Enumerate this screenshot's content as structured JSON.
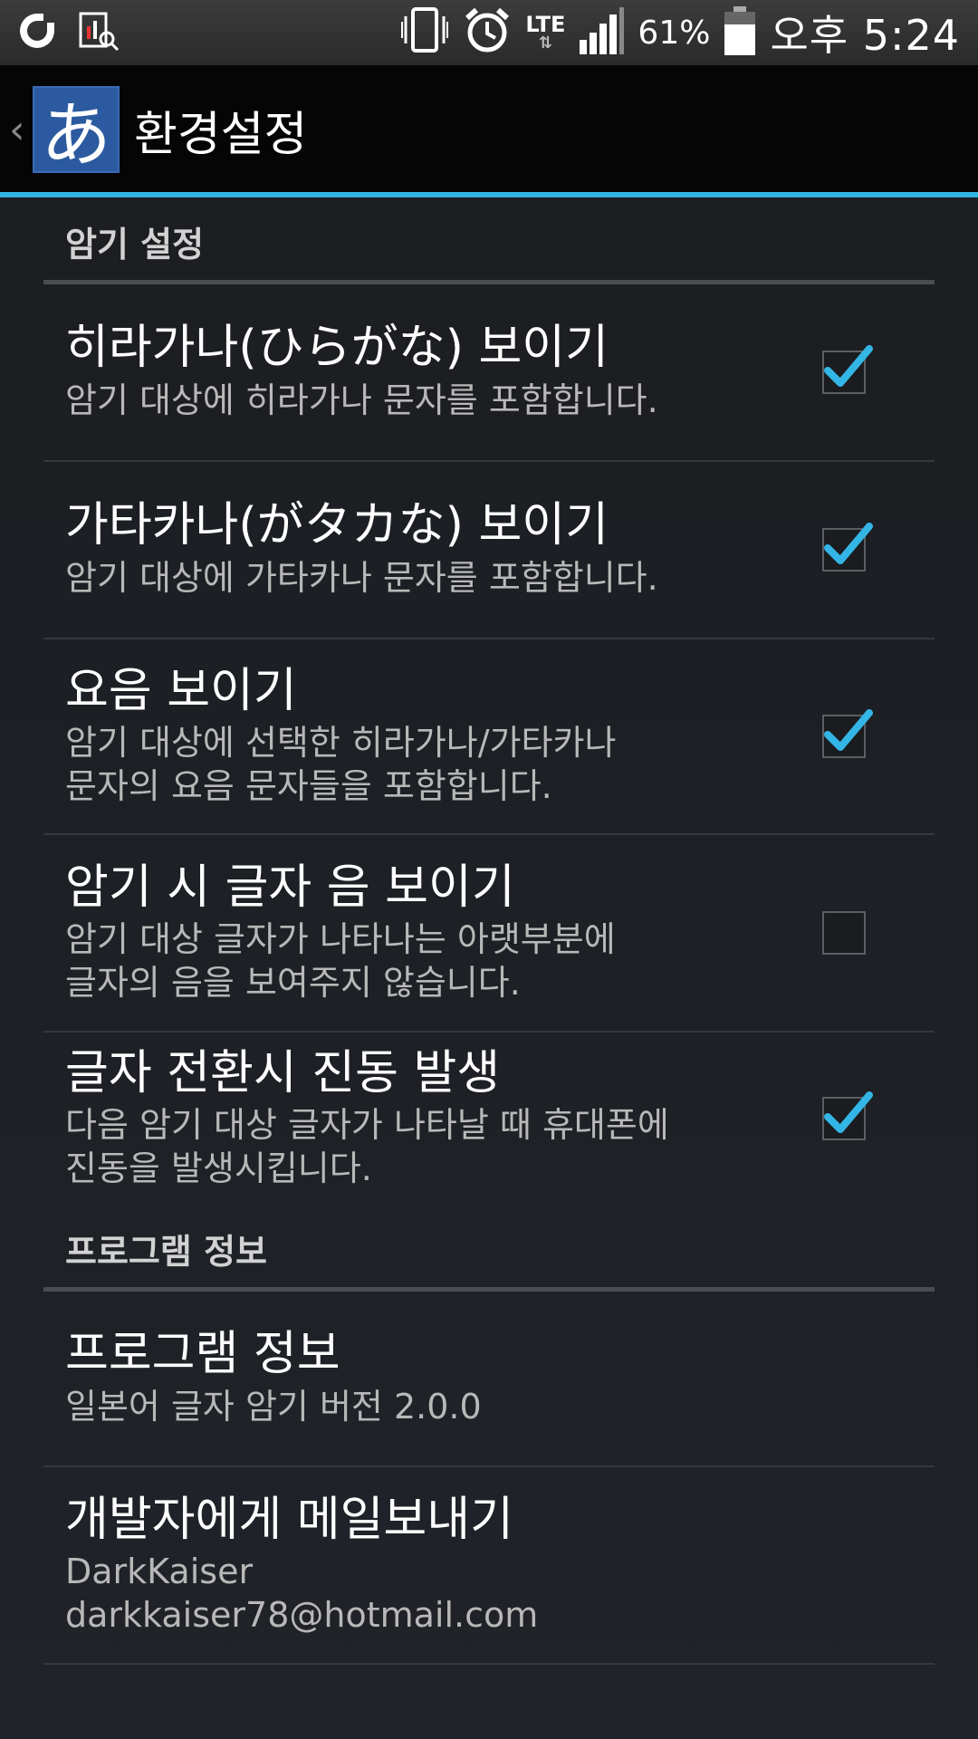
{
  "statusbar": {
    "battery_percent": "61%",
    "time": "오후 5:24",
    "network": "LTE",
    "icons": [
      "app-logo-icon",
      "monitor-icon",
      "vibrate-icon",
      "alarm-icon",
      "lte-icon",
      "signal-icon",
      "battery-icon"
    ]
  },
  "actionbar": {
    "app_icon_glyph": "あ",
    "title": "환경설정"
  },
  "sections": {
    "memorize": {
      "header": "암기 설정",
      "items": [
        {
          "title": "히라가나(ひらがな) 보이기",
          "summary": "암기 대상에 히라가나 문자를 포함합니다.",
          "checked": true
        },
        {
          "title": "가타카나(がタカな) 보이기",
          "summary": "암기 대상에 가타카나 문자를 포함합니다.",
          "checked": true
        },
        {
          "title": "요음 보이기",
          "summary": "암기 대상에 선택한 히라가나/가타카나\n문자의 요음 문자들을 포함합니다.",
          "checked": true
        },
        {
          "title": "암기 시 글자 음 보이기",
          "summary": "암기 대상 글자가 나타나는 아랫부분에\n글자의 음을 보여주지 않습니다.",
          "checked": false
        },
        {
          "title": "글자 전환시 진동 발생",
          "summary": "다음 암기 대상 글자가 나타날 때 휴대폰에\n진동을 발생시킵니다.",
          "checked": true
        }
      ]
    },
    "info": {
      "header": "프로그램 정보",
      "items": [
        {
          "title": "프로그램 정보",
          "summary": "일본어 글자 암기 버전 2.0.0"
        },
        {
          "title": "개발자에게 메일보내기",
          "summary": "DarkKaiser\ndarkkaiser78@hotmail.com"
        }
      ]
    }
  },
  "colors": {
    "accent": "#33b5e5",
    "app_icon_bg": "#2c5aa0",
    "background": "#1d2025"
  }
}
